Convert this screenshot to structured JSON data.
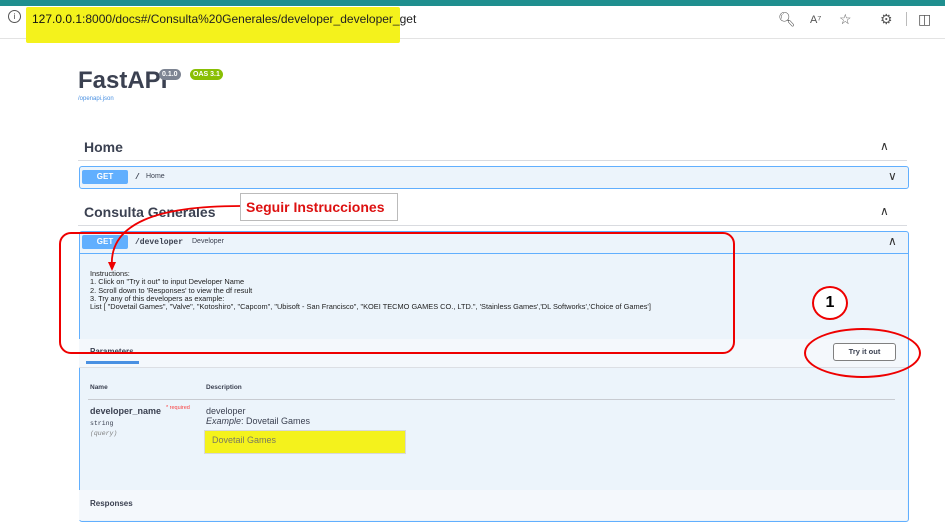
{
  "browser": {
    "url_host": "127.0.0.1",
    "url_rest": ":8000/docs#/Consulta%20Generales/developer_developer_get"
  },
  "app": {
    "title": "FastAPI",
    "version_badge": "0.1.0",
    "oas_badge": "OAS 3.1",
    "openapi_link": "/openapi.json"
  },
  "sections": [
    {
      "title": "Home",
      "operation": {
        "method": "GET",
        "path": "/",
        "summary": "Home"
      }
    },
    {
      "title": "Consulta Generales",
      "operation": {
        "method": "GET",
        "path": "/developer",
        "summary": "Developer",
        "instructions": [
          "Instructions:",
          "1. Click on \"Try it out\" to input Developer Name",
          "2. Scroll down to 'Responses' to view the df result",
          "3. Try any of this developers as example:",
          "List [ \"Dovetail Games\", \"Valve\", \"Kotoshiro\", \"Capcom\", \"Ubisoft - San Francisco\", \"KOEI TECMO GAMES CO., LTD.\", 'Stainless Games','DL Softworks','Choice of Games']"
        ],
        "parameters_tab": "Parameters",
        "try_button": "Try it out",
        "col_name": "Name",
        "col_description": "Description",
        "param": {
          "name": "developer_name",
          "required_mark": "* required",
          "type": "string",
          "in": "(query)",
          "description": "developer",
          "example_label": "Example",
          "example_value": ": Dovetail Games",
          "input_value": "Dovetail Games"
        },
        "responses_label": "Responses"
      }
    }
  ],
  "annotations": {
    "callout_text": "Seguir Instrucciones",
    "step_number": "1",
    "highlight_color": "#f4f21c",
    "annotation_color": "#e00000"
  },
  "icons": [
    "info-icon",
    "zoom-icon",
    "read-aloud-icon",
    "favorite-star-icon",
    "extensions-icon",
    "split-screen-icon",
    "chevron-up-icon",
    "chevron-down-icon"
  ]
}
